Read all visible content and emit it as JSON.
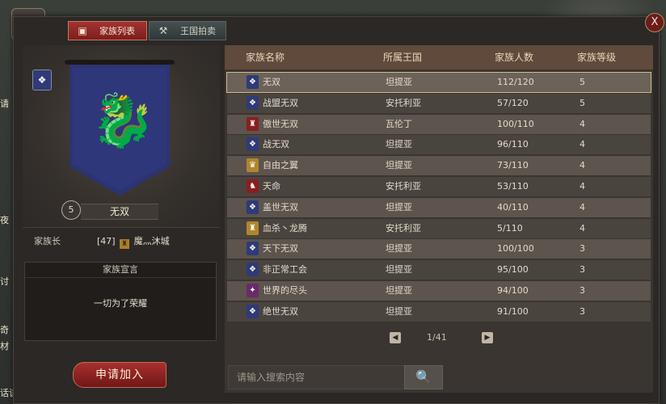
{
  "side_labels": [
    "请",
    "夜",
    "讨",
    "奇",
    "材",
    "话谈"
  ],
  "tabs": [
    {
      "label": "家族列表",
      "icon": "banner-icon",
      "glyph": "▣",
      "active": true
    },
    {
      "label": "王国拍卖",
      "icon": "hammer-icon",
      "glyph": "⚒",
      "active": false
    }
  ],
  "close_glyph": "X",
  "emblem_glyph": "✝",
  "family": {
    "name": "无双",
    "level": "5",
    "leader_label": "家族长",
    "leader_value_prefix": "[47]",
    "leader_icon_glyph": "♜",
    "leader_name": "魔灬沐城",
    "manifesto_title": "家族宣言",
    "manifesto_text": "一切为了荣耀",
    "badge_glyph": "❖",
    "dragon_glyph": "🐉"
  },
  "apply_button": "申请加入",
  "table": {
    "headers": [
      "家族名称",
      "所属王国",
      "家族人数",
      "家族等级"
    ],
    "rows": [
      {
        "emblem_color": "#2f3a78",
        "glyph": "❖",
        "name": "无双",
        "kingdom": "坦提亚",
        "members": "112/120",
        "level": "5"
      },
      {
        "emblem_color": "#2f3a78",
        "glyph": "❖",
        "name": "战盟无双",
        "kingdom": "安托利亚",
        "members": "57/120",
        "level": "5"
      },
      {
        "emblem_color": "#8a1e1e",
        "glyph": "♜",
        "name": "傲世无双",
        "kingdom": "瓦伦丁",
        "members": "100/110",
        "level": "4"
      },
      {
        "emblem_color": "#2f3a78",
        "glyph": "❖",
        "name": "战无双",
        "kingdom": "坦提亚",
        "members": "96/110",
        "level": "4"
      },
      {
        "emblem_color": "#b0862c",
        "glyph": "♛",
        "name": "自由之翼",
        "kingdom": "坦提亚",
        "members": "73/110",
        "level": "4"
      },
      {
        "emblem_color": "#8a1e1e",
        "glyph": "♞",
        "name": "天命",
        "kingdom": "安托利亚",
        "members": "53/110",
        "level": "4"
      },
      {
        "emblem_color": "#2f3a78",
        "glyph": "❖",
        "name": "盖世无双",
        "kingdom": "坦提亚",
        "members": "40/110",
        "level": "4"
      },
      {
        "emblem_color": "#b0862c",
        "glyph": "♜",
        "name": "血杀丶龙腾",
        "kingdom": "安托利亚",
        "members": "5/110",
        "level": "4"
      },
      {
        "emblem_color": "#2f3a78",
        "glyph": "❖",
        "name": "天下无双",
        "kingdom": "坦提亚",
        "members": "100/100",
        "level": "3"
      },
      {
        "emblem_color": "#2f3a78",
        "glyph": "❖",
        "name": "非正常工会",
        "kingdom": "坦提亚",
        "members": "95/100",
        "level": "3"
      },
      {
        "emblem_color": "#6b2a6b",
        "glyph": "✦",
        "name": "世界的尽头",
        "kingdom": "坦提亚",
        "members": "94/100",
        "level": "3"
      },
      {
        "emblem_color": "#2f3a78",
        "glyph": "❖",
        "name": "绝世无双",
        "kingdom": "坦提亚",
        "members": "91/100",
        "level": "3"
      }
    ]
  },
  "pager": {
    "text": "1/41",
    "prev_glyph": "◀",
    "next_glyph": "▶"
  },
  "search": {
    "placeholder": "请输入搜索内容",
    "icon_glyph": "🔍"
  }
}
